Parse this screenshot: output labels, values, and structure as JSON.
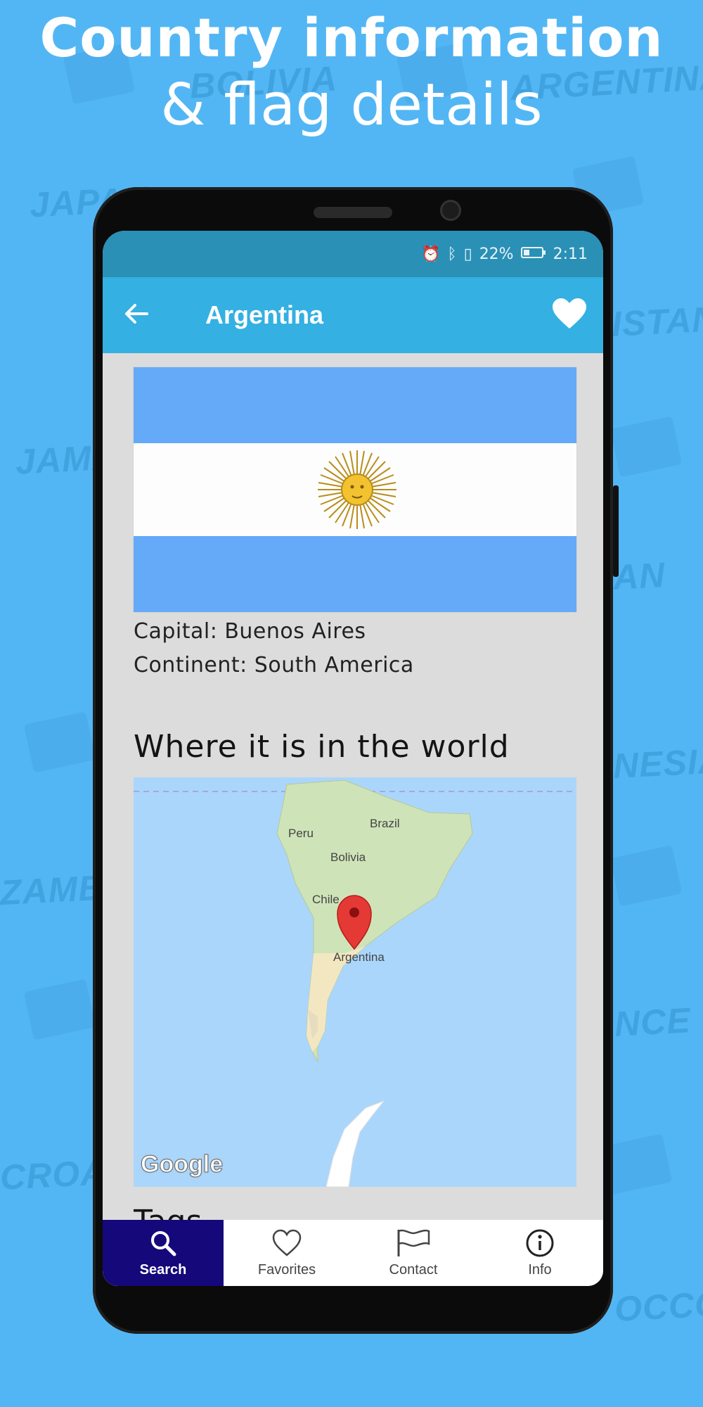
{
  "headline": {
    "line1": "Country information",
    "line2": "& flag details"
  },
  "background_words": [
    "BOLIVIA",
    "ARGENTINA",
    "JAPAN",
    "ISTAN",
    "JAMA",
    "AN",
    "NESIA",
    "ZAMBI",
    "NCE",
    "CROATI",
    "OCCO"
  ],
  "status_bar": {
    "battery": "22%",
    "time": "2:11",
    "icons": [
      "alarm-icon",
      "bluetooth-icon",
      "vibrate-icon",
      "battery-icon"
    ]
  },
  "app_bar": {
    "title": "Argentina",
    "back_icon": "arrow-left-icon",
    "favorite_icon": "heart-filled-icon"
  },
  "country": {
    "capital": "Capital: Buenos Aires",
    "continent": "Continent: South America",
    "flag_colors": {
      "blue": "#64aaf8",
      "white": "#fdfdfd",
      "sun": "#e8b82c"
    }
  },
  "map_section": {
    "title": "Where it is in the world",
    "labels": {
      "brazil": "Brazil",
      "peru": "Peru",
      "bolivia": "Bolivia",
      "chile": "Chile",
      "argentina": "Argentina"
    },
    "attribution": "Google",
    "pin_color": "#e53935"
  },
  "next_section_partial": "Tags",
  "bottom_nav": {
    "items": [
      {
        "label": "Search",
        "icon": "search-icon",
        "active": true
      },
      {
        "label": "Favorites",
        "icon": "heart-outline-icon",
        "active": false
      },
      {
        "label": "Contact",
        "icon": "flag-icon",
        "active": false
      },
      {
        "label": "Info",
        "icon": "info-icon",
        "active": false
      }
    ]
  },
  "colors": {
    "background": "#53b6f4",
    "status_bar": "#2a90b6",
    "app_bar": "#34b0e2",
    "nav_active": "#15087a"
  }
}
